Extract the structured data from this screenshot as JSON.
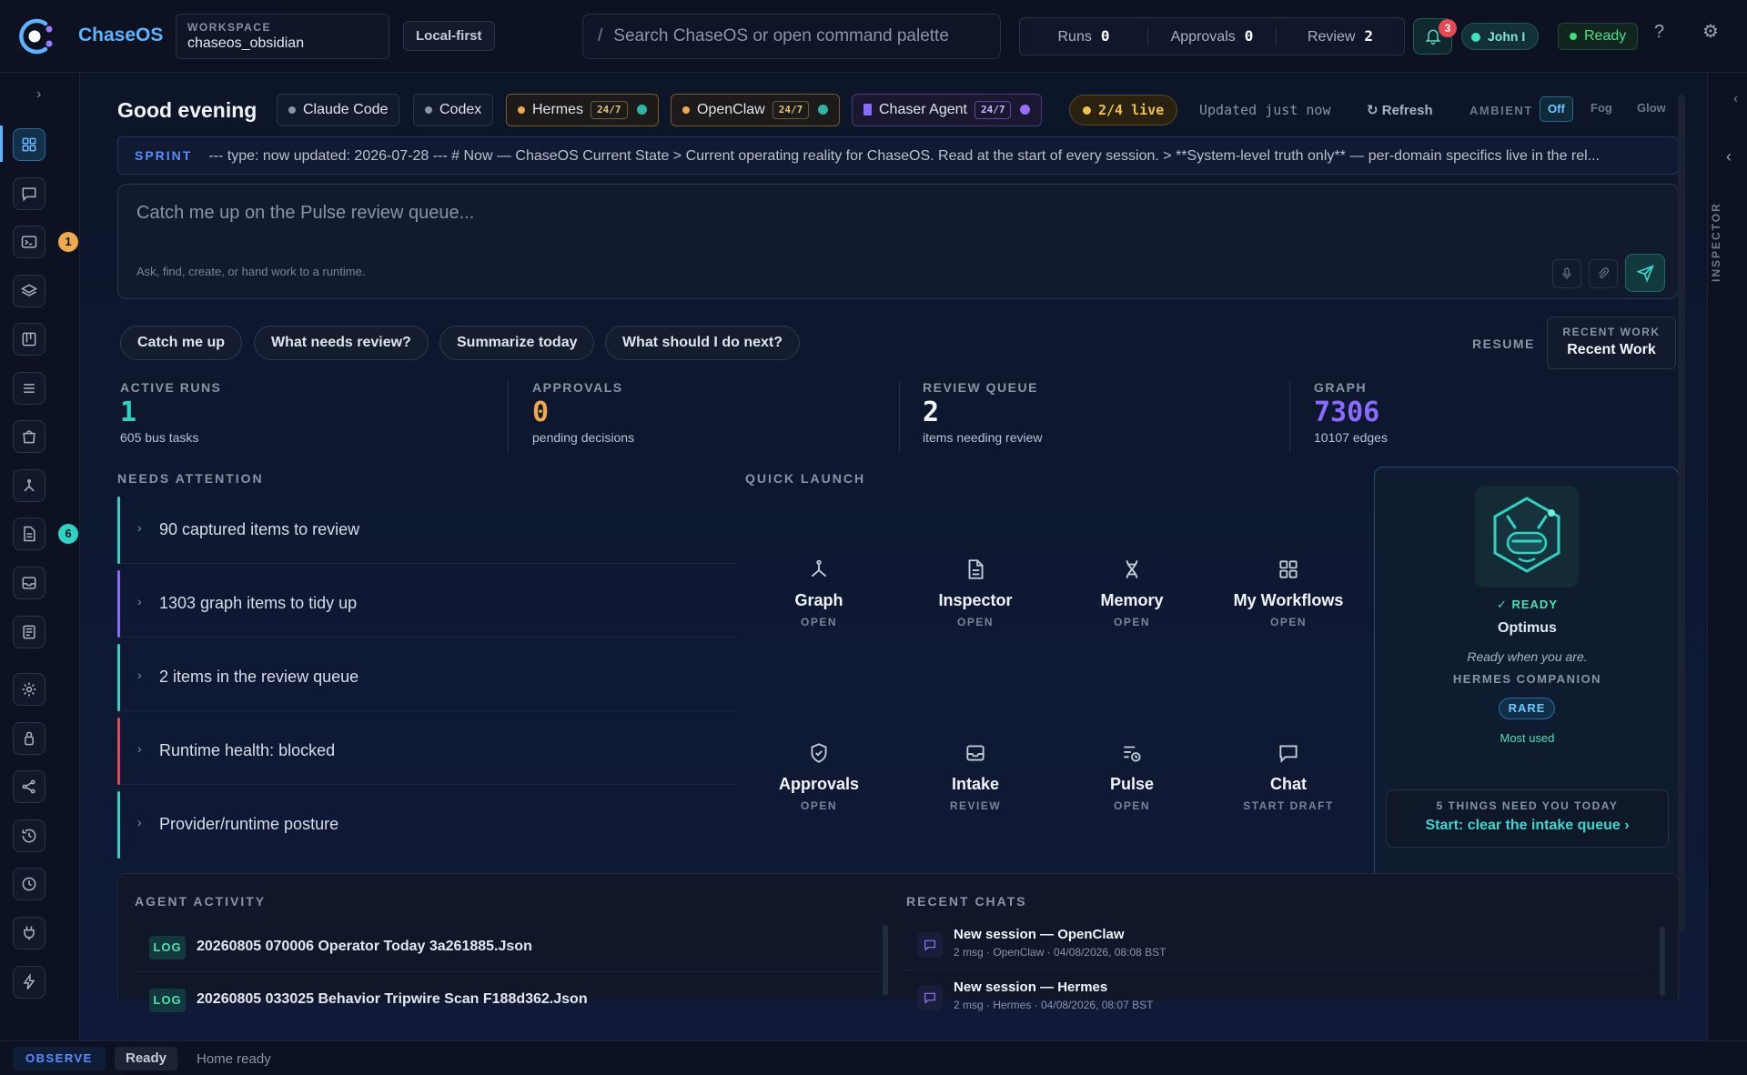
{
  "topbar": {
    "brand": "ChaseOS",
    "workspace_label": "WORKSPACE",
    "workspace_value": "chaseos_obsidian",
    "mode_pill": "Local-first",
    "search_prefix": "/",
    "search_placeholder": "Search ChaseOS or open command palette",
    "counters": [
      {
        "label": "Runs",
        "value": "0"
      },
      {
        "label": "Approvals",
        "value": "0"
      },
      {
        "label": "Review",
        "value": "2"
      }
    ],
    "notifications_count": "3",
    "user_name": "John I",
    "status": "Ready",
    "help_glyph": "?",
    "settings_glyph": "⚙"
  },
  "rail": {
    "expand_glyph": "›",
    "badges": {
      "terminal": "1",
      "docs": "6"
    }
  },
  "header": {
    "greeting": "Good evening",
    "runtimes": [
      {
        "name": "Claude Code",
        "badge": ""
      },
      {
        "name": "Codex",
        "badge": ""
      },
      {
        "name": "Hermes",
        "badge": "24/7"
      },
      {
        "name": "OpenClaw",
        "badge": "24/7"
      },
      {
        "name": "Chaser Agent",
        "badge": "24/7"
      }
    ],
    "live": "2/4 live",
    "updated": "Updated just now",
    "refresh": "Refresh",
    "ambient_label": "AMBIENT",
    "ambient_options": [
      "Off",
      "Fog",
      "Glow"
    ]
  },
  "sprint": {
    "tag": "SPRINT",
    "text": "--- type: now updated: 2026-07-28 --- # Now — ChaseOS Current State > Current operating reality for ChaseOS. Read at the start of every session. > **System-level truth only** — per-domain specifics live in the rel..."
  },
  "composer": {
    "placeholder": "Catch me up on the Pulse review queue...",
    "hint": "Ask, find, create, or hand work to a runtime."
  },
  "quick_prompts": [
    "Catch me up",
    "What needs review?",
    "Summarize today",
    "What should I do next?"
  ],
  "resume": {
    "label": "RESUME",
    "recent_work_label": "RECENT WORK",
    "recent_work_value": "Recent Work"
  },
  "stats": [
    {
      "label": "ACTIVE RUNS",
      "value": "1",
      "sub": "605 bus tasks"
    },
    {
      "label": "APPROVALS",
      "value": "0",
      "sub": "pending decisions"
    },
    {
      "label": "REVIEW QUEUE",
      "value": "2",
      "sub": "items needing review"
    },
    {
      "label": "GRAPH",
      "value": "7306",
      "sub": "10107 edges"
    }
  ],
  "needs_attention": {
    "title": "NEEDS ATTENTION",
    "items": [
      "90 captured items to review",
      "1303 graph items to tidy up",
      "2 items in the review queue",
      "Runtime health: blocked",
      "Provider/runtime posture"
    ]
  },
  "quick_launch": {
    "title": "QUICK LAUNCH",
    "items": [
      {
        "name": "Graph",
        "action": "OPEN"
      },
      {
        "name": "Inspector",
        "action": "OPEN"
      },
      {
        "name": "Memory",
        "action": "OPEN"
      },
      {
        "name": "My Workflows",
        "action": "OPEN"
      },
      {
        "name": "Approvals",
        "action": "OPEN"
      },
      {
        "name": "Intake",
        "action": "REVIEW"
      },
      {
        "name": "Pulse",
        "action": "OPEN"
      },
      {
        "name": "Chat",
        "action": "START DRAFT"
      }
    ]
  },
  "companion": {
    "status": "✓ READY",
    "name": "Optimus",
    "tagline": "Ready when you are.",
    "role": "HERMES COMPANION",
    "rarity": "RARE",
    "usage": "Most used",
    "cta_label": "5 THINGS NEED YOU TODAY",
    "cta_action": "Start: clear the intake queue ›"
  },
  "agent_activity": {
    "title": "AGENT ACTIVITY",
    "items": [
      {
        "tag": "LOG",
        "text": "20260805 070006 Operator Today 3a261885.Json"
      },
      {
        "tag": "LOG",
        "text": "20260805 033025 Behavior Tripwire Scan F188d362.Json"
      }
    ]
  },
  "recent_chats": {
    "title": "RECENT CHATS",
    "items": [
      {
        "title": "New session — OpenClaw",
        "meta": "2 msg · OpenClaw · 04/08/2026, 08:08 BST"
      },
      {
        "title": "New session — Hermes",
        "meta": "2 msg · Hermes · 04/08/2026, 08:07 BST"
      }
    ]
  },
  "inspector": {
    "label": "INSPECTOR"
  },
  "statusbar": {
    "mode": "OBSERVE",
    "state": "Ready",
    "message": "Home ready"
  },
  "colors": {
    "accent": "#5eb3ff",
    "teal": "#2fd3c4",
    "orange": "#f0a94a",
    "violet": "#8b6bff",
    "red": "#e8484f",
    "green": "#4fe08a"
  }
}
